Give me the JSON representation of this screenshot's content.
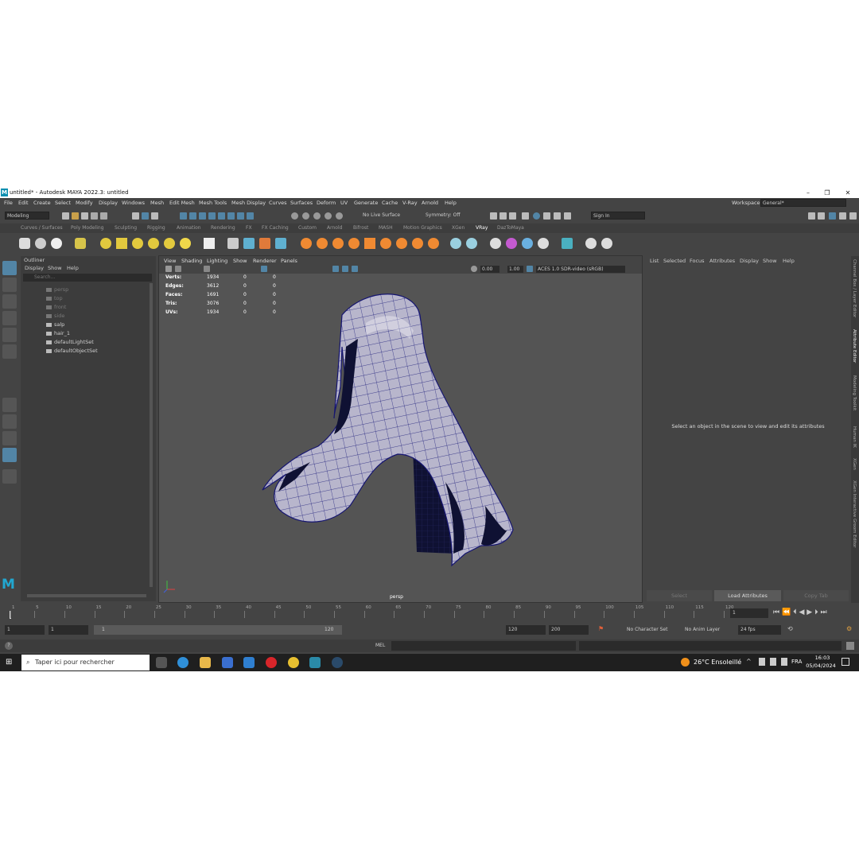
{
  "window": {
    "title": "untitled* - Autodesk MAYA 2022.3: untitled",
    "logo": "M"
  },
  "menubar": {
    "items": [
      "File",
      "Edit",
      "Create",
      "Select",
      "Modify",
      "Display",
      "Windows",
      "Mesh",
      "Edit Mesh",
      "Mesh Tools",
      "Mesh Display",
      "Curves",
      "Surfaces",
      "Deform",
      "UV",
      "Generate",
      "Cache",
      "V-Ray",
      "Arnold",
      "Help"
    ],
    "workspace_label": "Workspace:",
    "workspace_value": "General*"
  },
  "statusline": {
    "mode": "Modeling",
    "live_surface": "No Live Surface",
    "symmetry": "Symmetry: Off",
    "sign_in": "Sign In"
  },
  "shelf": {
    "tabs": [
      "Curves / Surfaces",
      "Poly Modeling",
      "Sculpting",
      "Rigging",
      "Animation",
      "Rendering",
      "FX",
      "FX Caching",
      "Custom",
      "Arnold",
      "Bifrost",
      "MASH",
      "Motion Graphics",
      "XGen",
      "VRay",
      "DazToMaya"
    ],
    "active_tab": "VRay"
  },
  "outliner": {
    "title": "Outliner",
    "menus": [
      "Display",
      "Show",
      "Help"
    ],
    "search_placeholder": "Search...",
    "items": [
      {
        "label": "persp",
        "dim": true
      },
      {
        "label": "top",
        "dim": true
      },
      {
        "label": "front",
        "dim": true
      },
      {
        "label": "side",
        "dim": true
      },
      {
        "label": "salp",
        "dim": false
      },
      {
        "label": "hair_1",
        "dim": false
      },
      {
        "label": "defaultLightSet",
        "dim": false
      },
      {
        "label": "defaultObjectSet",
        "dim": false
      }
    ]
  },
  "viewport": {
    "menus": [
      "View",
      "Shading",
      "Lighting",
      "Show",
      "Renderer",
      "Panels"
    ],
    "exposure": "0.00",
    "gamma": "1.00",
    "color_space": "ACES 1.0 SDR-video (sRGB)",
    "camera": "persp",
    "hud": [
      {
        "label": "Verts:",
        "v1": "1934",
        "v2": "0",
        "v3": "0"
      },
      {
        "label": "Edges:",
        "v1": "3612",
        "v2": "0",
        "v3": "0"
      },
      {
        "label": "Faces:",
        "v1": "1691",
        "v2": "0",
        "v3": "0"
      },
      {
        "label": "Tris:",
        "v1": "3076",
        "v2": "0",
        "v3": "0"
      },
      {
        "label": "UVs:",
        "v1": "1934",
        "v2": "0",
        "v3": "0"
      }
    ]
  },
  "attribute_editor": {
    "menus": [
      "List",
      "Selected",
      "Focus",
      "Attributes",
      "Display",
      "Show",
      "Help"
    ],
    "message": "Select an object in the scene to view and edit its attributes",
    "buttons": [
      "Select",
      "Load Attributes",
      "Copy Tab"
    ]
  },
  "side_tabs": [
    "Channel Box / Layer Editor",
    "Attribute Editor",
    "Modeling Toolkit",
    "Human IK",
    "XGen",
    "XGen Interactive Groom Editor"
  ],
  "timeline": {
    "ticks": [
      "1",
      "5",
      "10",
      "15",
      "20",
      "25",
      "30",
      "35",
      "40",
      "45",
      "50",
      "55",
      "60",
      "65",
      "70",
      "75",
      "80",
      "85",
      "90",
      "95",
      "100",
      "105",
      "110",
      "115",
      "120"
    ],
    "current_frame": "1"
  },
  "range": {
    "start": "1",
    "playback_start": "1",
    "slider_start": "1",
    "slider_end": "120",
    "playback_end": "120",
    "end": "200",
    "character_set": "No Character Set",
    "anim_layer": "No Anim Layer",
    "fps": "24 fps"
  },
  "cmdline": {
    "lang": "MEL",
    "help": "?"
  },
  "taskbar": {
    "search_placeholder": "Taper ici pour rechercher",
    "weather": "26°C  Ensoleillé",
    "lang": "FRA",
    "time": "16:03",
    "date": "05/04/2024"
  },
  "colors": {
    "accent": "#5285a6",
    "maya_bg": "#444444",
    "viewport_bg": "#545454",
    "wire": "#1c1c7a"
  }
}
